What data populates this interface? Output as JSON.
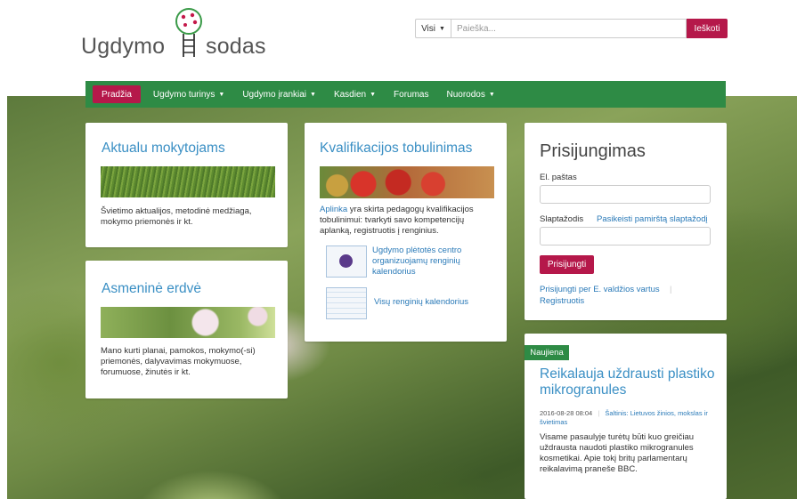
{
  "logo": {
    "part1": "Ugdymo",
    "part2": "sodas"
  },
  "search": {
    "scope": "Visi",
    "placeholder": "Paieška...",
    "button": "Ieškoti"
  },
  "nav": {
    "items": [
      {
        "label": "Pradžia",
        "active": true,
        "dropdown": false
      },
      {
        "label": "Ugdymo turinys",
        "active": false,
        "dropdown": true
      },
      {
        "label": "Ugdymo įrankiai",
        "active": false,
        "dropdown": true
      },
      {
        "label": "Kasdien",
        "active": false,
        "dropdown": true
      },
      {
        "label": "Forumas",
        "active": false,
        "dropdown": false
      },
      {
        "label": "Nuorodos",
        "active": false,
        "dropdown": true
      }
    ]
  },
  "cards": {
    "teachers": {
      "title": "Aktualu mokytojams",
      "text": "Švietimo aktualijos, metodinė medžiaga, mokymo priemonės ir kt."
    },
    "personal": {
      "title": "Asmeninė erdvė",
      "text": "Mano kurti planai, pamokos, mokymo(-si) priemonės,  dalyvavimas mokymuose, forumuose, žinutės ir kt."
    },
    "qualification": {
      "title": "Kvalifikacijos tobulinimas",
      "link_word": "Aplinka",
      "text": " yra skirta pedagogų kvalifikacijos tobulinimui: tvarkyti savo kompetencijų aplanką, registruotis į renginius.",
      "calendar1": "Ugdymo plėtotės centro organizuojamų renginių kalendorius",
      "calendar2": "Visų renginių kalendorius"
    }
  },
  "login": {
    "title": "Prisijungimas",
    "email_label": "El. paštas",
    "password_label": "Slaptažodis",
    "forgot_link": "Pasikeisti pamirštą slaptažodį",
    "submit": "Prisijungti",
    "gov_link": "Prisijungti per E. valdžios vartus",
    "register_link": "Registruotis"
  },
  "news": {
    "badge": "Naujiena",
    "title": "Reikalauja uždrausti plastiko mikrogranules",
    "date": "2016-08-28 08:04",
    "source": "Šaltinis: Lietuvos žinios, mokslas ir švietimas",
    "body": "Visame pasaulyje turėtų būti kuo greičiau uždrausta naudoti plastiko mikrogranules kosmetikai. Apie tokį britų parlamentarų reikalavimą praneše BBC."
  },
  "colors": {
    "brand_green": "#2e8b45",
    "accent_red": "#b5184a",
    "title_blue": "#3a8fc4",
    "link_blue": "#2a7ab8"
  }
}
